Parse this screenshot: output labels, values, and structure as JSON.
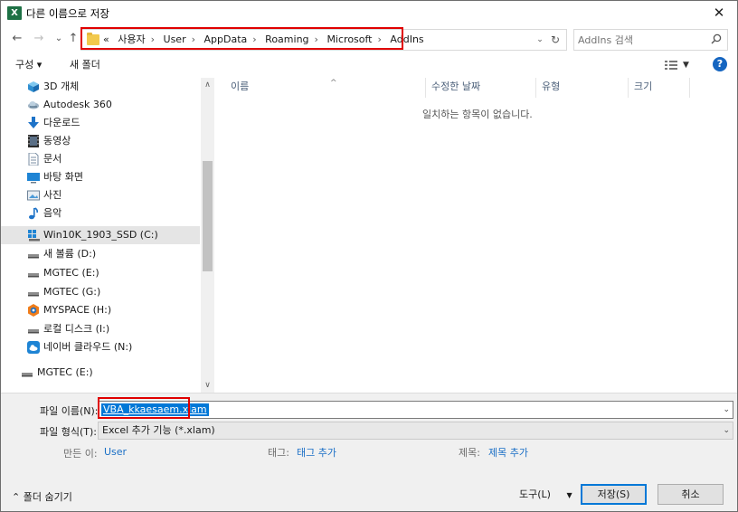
{
  "title": "다른 이름으로 저장",
  "app_icon_letter": "X",
  "nav": {
    "back": "←",
    "forward": "→",
    "recent": "⌄",
    "up": "↑"
  },
  "address": {
    "overflow": "«",
    "crumbs": [
      "사용자",
      "User",
      "AppData",
      "Roaming",
      "Microsoft",
      "AddIns"
    ],
    "separator": "›"
  },
  "search": {
    "placeholder": "AddIns 검색"
  },
  "toolbar": {
    "organize": "구성 ▾",
    "new_folder": "새 폴더",
    "help": "?"
  },
  "sidebar": {
    "items": [
      {
        "label": "3D 개체",
        "icon": "cube-icon"
      },
      {
        "label": "Autodesk 360",
        "icon": "cloud-sync-icon"
      },
      {
        "label": "다운로드",
        "icon": "download-icon"
      },
      {
        "label": "동영상",
        "icon": "video-icon"
      },
      {
        "label": "문서",
        "icon": "document-icon"
      },
      {
        "label": "바탕 화면",
        "icon": "desktop-icon"
      },
      {
        "label": "사진",
        "icon": "picture-icon"
      },
      {
        "label": "음악",
        "icon": "music-icon"
      },
      {
        "label": "Win10K_1903_SSD (C:)",
        "icon": "windows-drive-icon",
        "selected": true
      },
      {
        "label": "새 볼륨 (D:)",
        "icon": "drive-icon"
      },
      {
        "label": "MGTEC (E:)",
        "icon": "drive-icon"
      },
      {
        "label": "MGTEC (G:)",
        "icon": "drive-icon"
      },
      {
        "label": "MYSPACE (H:)",
        "icon": "myspace-drive-icon"
      },
      {
        "label": "로컬 디스크 (I:)",
        "icon": "drive-icon"
      },
      {
        "label": "네이버 클라우드 (N:)",
        "icon": "cloud-drive-icon"
      }
    ],
    "network_item": {
      "label": "MGTEC (E:)",
      "icon": "drive-icon"
    }
  },
  "content": {
    "columns": [
      "이름",
      "수정한 날짜",
      "유형",
      "크기"
    ],
    "empty_message": "일치하는 항목이 없습니다."
  },
  "form": {
    "filename_label": "파일 이름(N):",
    "filename_value": "VBA_kkaesaem.xlam",
    "filetype_label": "파일 형식(T):",
    "filetype_value": "Excel 추가 기능 (*.xlam)",
    "authors_label": "만든 이:",
    "authors_value": "User",
    "tags_label": "태그:",
    "tags_value": "태그 추가",
    "title_label": "제목:",
    "title_value": "제목 추가"
  },
  "footer": {
    "hide_folders": "⌃  폴더 숨기기",
    "tools": "도구(L)",
    "tools_arrow": "▼",
    "save": "저장(S)",
    "cancel": "취소"
  },
  "colors": {
    "highlight_red": "#e00000",
    "selection_blue": "#0078d7",
    "link_blue": "#1a6fc6"
  }
}
